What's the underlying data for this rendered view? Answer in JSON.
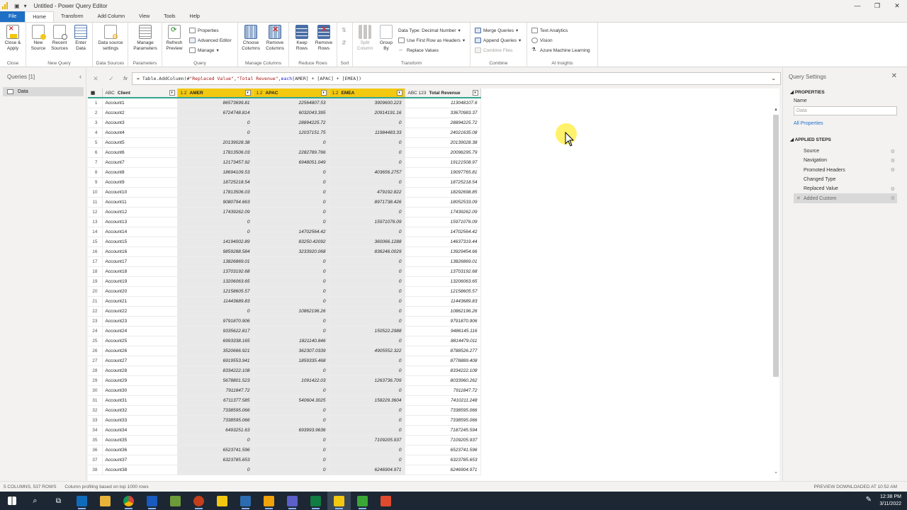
{
  "window": {
    "title": "Untitled - Power Query Editor"
  },
  "tabs": [
    "File",
    "Home",
    "Transform",
    "Add Column",
    "View",
    "Tools",
    "Help"
  ],
  "ribbon": {
    "close_apply": "Close &\nApply",
    "new_source": "New\nSource",
    "recent_sources": "Recent\nSources",
    "enter_data": "Enter\nData",
    "data_source_settings": "Data source\nsettings",
    "manage_parameters": "Manage\nParameters",
    "refresh_preview": "Refresh\nPreview",
    "properties": "Properties",
    "advanced_editor": "Advanced Editor",
    "manage": "Manage",
    "choose_columns": "Choose\nColumns",
    "remove_columns": "Remove\nColumns",
    "keep_rows": "Keep\nRows",
    "remove_rows": "Remove\nRows",
    "split_column": "Split\nColumn",
    "group_by": "Group\nBy",
    "data_type": "Data Type: Decimal Number",
    "use_first_row": "Use First Row as Headers",
    "replace_values": "Replace Values",
    "merge_queries": "Merge Queries",
    "append_queries": "Append Queries",
    "combine_files": "Combine Files",
    "text_analytics": "Text Analytics",
    "vision": "Vision",
    "azure_ml": "Azure Machine Learning",
    "groups": {
      "close": "Close",
      "new_query": "New Query",
      "data_sources": "Data Sources",
      "parameters": "Parameters",
      "query": "Query",
      "manage_columns": "Manage Columns",
      "reduce_rows": "Reduce Rows",
      "sort": "Sort",
      "transform": "Transform",
      "combine": "Combine",
      "ai_insights": "AI Insights"
    }
  },
  "queries_panel": {
    "header": "Queries [1]",
    "items": [
      "Data"
    ]
  },
  "formula": {
    "fx": "fx",
    "prefix": "= Table.AddColumn(#",
    "s1": "\"Replaced Value\"",
    "c1": ", ",
    "s2": "\"Total Revenue\"",
    "c2": ", ",
    "kw": "each",
    "rest": " [AMER] + [APAC] + [EMEA])"
  },
  "columns": [
    {
      "type": "ABC",
      "name": "Client"
    },
    {
      "type": "1.2",
      "name": "AMER"
    },
    {
      "type": "1.2",
      "name": "APAC"
    },
    {
      "type": "1.2",
      "name": "EMEA"
    },
    {
      "type": "ABC 123",
      "name": "Total Revenue"
    }
  ],
  "rows": [
    [
      "Account1",
      "86573699.81",
      "22564807.53",
      "3909600.223",
      "113048107.6"
    ],
    [
      "Account2",
      "6724748.814",
      "6032043.395",
      "20914191.16",
      "33670983.37"
    ],
    [
      "Account3",
      "0",
      "28894225.72",
      "0",
      "28894225.72"
    ],
    [
      "Account4",
      "0",
      "12037151.75",
      "11984483.33",
      "24021635.08"
    ],
    [
      "Account5",
      "20139028.38",
      "0",
      "0",
      "20139028.38"
    ],
    [
      "Account6",
      "17813506.03",
      "2282789.766",
      "0",
      "20096295.79"
    ],
    [
      "Account7",
      "12173457.92",
      "6948051.049",
      "0",
      "19121508.97"
    ],
    [
      "Account8",
      "18694109.53",
      "0",
      "403656.2757",
      "19097765.81"
    ],
    [
      "Account9",
      "18725218.54",
      "0",
      "0",
      "18725218.54"
    ],
    [
      "Account10",
      "17813506.03",
      "0",
      "479192.822",
      "18292698.85"
    ],
    [
      "Account11",
      "9080794.663",
      "0",
      "8971738.426",
      "18052533.09"
    ],
    [
      "Account12",
      "17439262.09",
      "0",
      "0",
      "17439262.09"
    ],
    [
      "Account13",
      "0",
      "0",
      "15971076.09",
      "15971076.09"
    ],
    [
      "Account14",
      "0",
      "14702564.42",
      "0",
      "14702564.42"
    ],
    [
      "Account15",
      "14194002.89",
      "83250.42092",
      "360066.1288",
      "14637319.44"
    ],
    [
      "Account16",
      "9859288.584",
      "3233920.068",
      "836246.0029",
      "13929454.66"
    ],
    [
      "Account17",
      "13826869.01",
      "0",
      "0",
      "13826869.01"
    ],
    [
      "Account18",
      "13703192.68",
      "0",
      "0",
      "13703192.68"
    ],
    [
      "Account19",
      "13206063.65",
      "0",
      "0",
      "13206063.65"
    ],
    [
      "Account20",
      "12158605.57",
      "0",
      "0",
      "12158605.57"
    ],
    [
      "Account21",
      "11443689.83",
      "0",
      "0",
      "11443689.83"
    ],
    [
      "Account22",
      "0",
      "10862196.26",
      "0",
      "10862196.26"
    ],
    [
      "Account23",
      "9791870.906",
      "0",
      "0",
      "9791870.906"
    ],
    [
      "Account24",
      "9335622.817",
      "0",
      "150522.2988",
      "9486145.116"
    ],
    [
      "Account25",
      "6993338.165",
      "1821140.846",
      "0",
      "8814479.011"
    ],
    [
      "Account26",
      "3520666.921",
      "362307.0339",
      "4905552.322",
      "8788526.277"
    ],
    [
      "Account27",
      "6919553.941",
      "1859335.468",
      "0",
      "8778889.408"
    ],
    [
      "Account28",
      "8334222.108",
      "0",
      "0",
      "8334222.108"
    ],
    [
      "Account29",
      "5678801.523",
      "1091422.03",
      "1263736.709",
      "8033960.262"
    ],
    [
      "Account30",
      "7911847.72",
      "0",
      "0",
      "7911847.72"
    ],
    [
      "Account31",
      "6711377.585",
      "540604.3025",
      "158229.3604",
      "7410211.248"
    ],
    [
      "Account32",
      "7338595.066",
      "0",
      "0",
      "7338595.066"
    ],
    [
      "Account33",
      "7338595.066",
      "0",
      "0",
      "7338595.066"
    ],
    [
      "Account34",
      "6493251.63",
      "693993.9636",
      "0",
      "7187245.594"
    ],
    [
      "Account35",
      "0",
      "0",
      "7109205.937",
      "7109205.937"
    ],
    [
      "Account36",
      "6523741.596",
      "0",
      "0",
      "6523741.596"
    ],
    [
      "Account37",
      "6323785.653",
      "0",
      "0",
      "6323785.653"
    ],
    [
      "Account38",
      "0",
      "0",
      "6246904.971",
      "6246904.971"
    ]
  ],
  "settings": {
    "title": "Query Settings",
    "properties": "PROPERTIES",
    "name_label": "Name",
    "name_value": "Data",
    "all_properties": "All Properties",
    "applied_steps": "APPLIED STEPS",
    "steps": [
      "Source",
      "Navigation",
      "Promoted Headers",
      "Changed Type",
      "Replaced Value",
      "Added Custom"
    ]
  },
  "status": {
    "columns_rows": "5 COLUMNS, 537 ROWS",
    "profiling": "Column profiling based on top 1000 rows",
    "preview": "PREVIEW DOWNLOADED AT 10:52 AM"
  },
  "taskbar": {
    "time": "12:38 PM",
    "date": "3/11/2022"
  },
  "colors": {
    "accent": "#f2c811",
    "file_tab": "#1f6fc5",
    "grid_line": "#33a490"
  }
}
